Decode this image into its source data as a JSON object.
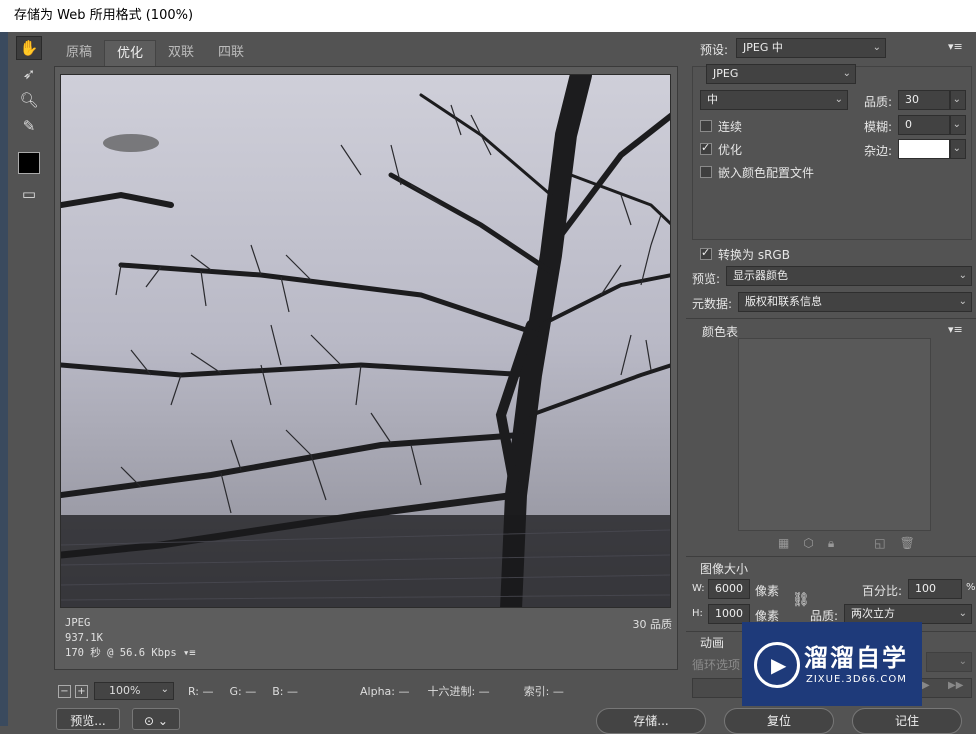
{
  "title": "存储为 Web 所用格式 (100%)",
  "tabs": [
    "原稿",
    "优化",
    "双联",
    "四联"
  ],
  "image_info": {
    "format": "JPEG",
    "size": "937.1K",
    "speed": "170 秒 @ 56.6 Kbps",
    "quality_label": "30 品质"
  },
  "zoom": "100%",
  "readout": {
    "r": "R: —",
    "g": "G: —",
    "b": "B: —",
    "alpha": "Alpha: —",
    "hex": "十六进制: —",
    "index": "索引: —"
  },
  "preset": {
    "label": "预设:",
    "value": "JPEG 中"
  },
  "format_value": "JPEG",
  "quality_mode": "中",
  "quality": {
    "label": "品质:",
    "value": "30"
  },
  "blur": {
    "label": "模糊:",
    "value": "0"
  },
  "matte": {
    "label": "杂边:"
  },
  "options": {
    "progressive": "连续",
    "optimized": "优化",
    "embed_profile": "嵌入颜色配置文件",
    "convert_srgb": "转换为 sRGB"
  },
  "preview": {
    "label": "预览:",
    "value": "显示器颜色"
  },
  "metadata": {
    "label": "元数据:",
    "value": "版权和联系信息"
  },
  "color_table_title": "颜色表",
  "image_size": {
    "title": "图像大小",
    "w_label": "W:",
    "w_value": "6000",
    "h_label": "H:",
    "h_value": "1000",
    "unit": "像素",
    "percent_label": "百分比:",
    "percent_value": "100",
    "percent_unit": "%",
    "quality_label": "品质:",
    "quality_value": "两次立方"
  },
  "animation": {
    "title": "动画",
    "loop_label": "循环选项"
  },
  "buttons": {
    "preview": "预览...",
    "save": "存储...",
    "reset": "复位",
    "remember": "记住"
  },
  "watermark": {
    "title": "溜溜自学",
    "url": "ZIXUE.3D66.COM"
  }
}
